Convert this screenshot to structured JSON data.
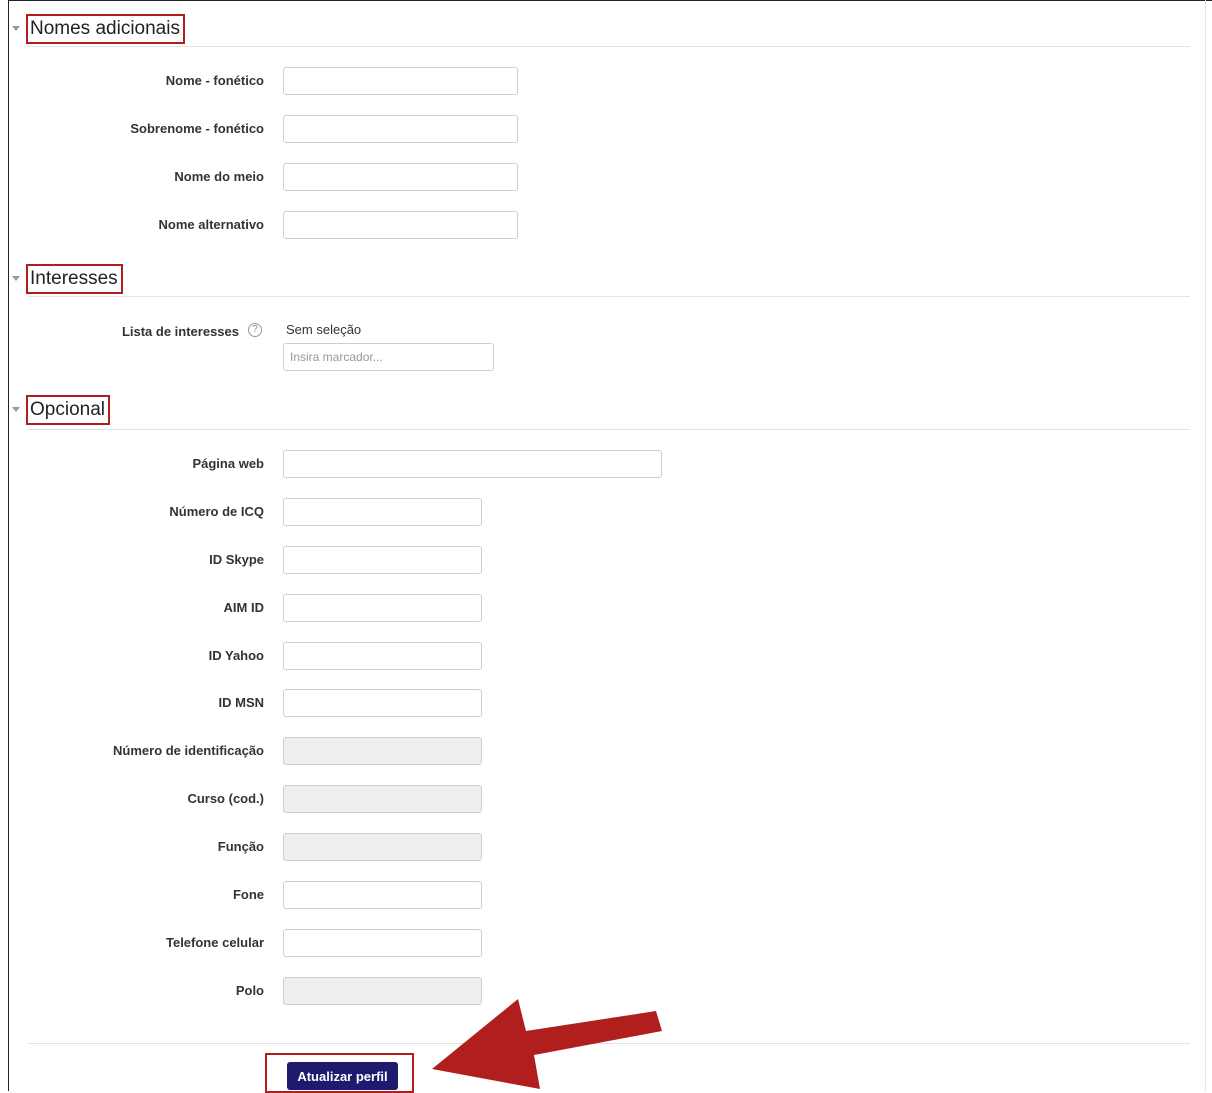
{
  "sections": {
    "nomes": {
      "title": "Nomes adicionais"
    },
    "interesses": {
      "title": "Interesses"
    },
    "opcional": {
      "title": "Opcional"
    }
  },
  "nomes_fields": [
    {
      "label": "Nome - fonético",
      "value": ""
    },
    {
      "label": "Sobrenome - fonético",
      "value": ""
    },
    {
      "label": "Nome do meio",
      "value": ""
    },
    {
      "label": "Nome alternativo",
      "value": ""
    }
  ],
  "interesses": {
    "label": "Lista de interesses",
    "help_icon": "?",
    "selection_text": "Sem seleção",
    "tag_placeholder": "Insira marcador..."
  },
  "opcional_fields": [
    {
      "label": "Página web",
      "value": "",
      "disabled": false
    },
    {
      "label": "Número de ICQ",
      "value": "",
      "disabled": false
    },
    {
      "label": "ID Skype",
      "value": "",
      "disabled": false
    },
    {
      "label": "AIM ID",
      "value": "",
      "disabled": false
    },
    {
      "label": "ID Yahoo",
      "value": "",
      "disabled": false
    },
    {
      "label": "ID MSN",
      "value": "",
      "disabled": false
    },
    {
      "label": "Número de identificação",
      "value": "",
      "disabled": true
    },
    {
      "label": "Curso (cod.)",
      "value": "",
      "disabled": true
    },
    {
      "label": "Função",
      "value": "",
      "disabled": true
    },
    {
      "label": "Fone",
      "value": "",
      "disabled": false
    },
    {
      "label": "Telefone celular",
      "value": "",
      "disabled": false
    },
    {
      "label": "Polo",
      "value": "",
      "disabled": true
    }
  ],
  "submit": {
    "label": "Atualizar perfil"
  },
  "colors": {
    "highlight": "#b11e1e",
    "button": "#1e1b6e",
    "disabled_field": "#eeeeee"
  }
}
